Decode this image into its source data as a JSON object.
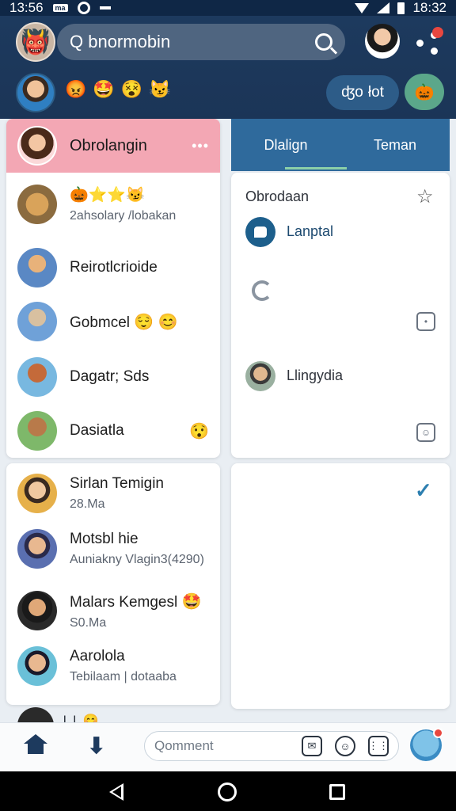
{
  "status_bar": {
    "time_left": "13:56",
    "badge": "ma",
    "time_right": "18:32"
  },
  "header": {
    "search_placeholder": "Q bnormobin",
    "emoji": [
      "😡",
      "🤩",
      "😵",
      "😼"
    ],
    "pill_left": "ʤo",
    "pill_right": "łot",
    "circle_button_icon": "🎃"
  },
  "left_panel_top": {
    "header_title": "Obrolangin",
    "header_more": "•••",
    "items": [
      {
        "name": "🎃⭐⭐😼",
        "sub": "2ahsolary /lobakan",
        "avatar_color": "#8b6b3f"
      },
      {
        "name": "Reirotlcrioide",
        "sub": "",
        "avatar_color": "#5a88c4"
      },
      {
        "name": "Gobmcel",
        "emoji": "😌 😊",
        "sub": "",
        "avatar_color": "#6fa1d8"
      },
      {
        "name": "Dagatr; Sds",
        "sub": "",
        "avatar_color": "#78b8e0"
      },
      {
        "name": "Dasiatla",
        "emoji": "😯",
        "sub": "",
        "avatar_color": "#7eb86a"
      }
    ]
  },
  "left_panel_bottom": {
    "items": [
      {
        "name": "Sirlan Temigin",
        "sub": "28.Ma",
        "avatar_color": "#e6b04a"
      },
      {
        "name": "Motsbl hie",
        "sub": "Auniakny Vlagin3(4290)",
        "avatar_color": "#5a6fb0"
      },
      {
        "name": "Malars Kemgesl",
        "emoji": "🤩",
        "sub": "S0.Ma",
        "avatar_color": "#2a2a2a"
      },
      {
        "name": "Aarolola",
        "sub": "Tebilaam | dotaaba",
        "avatar_color": "#6ac0d8"
      }
    ],
    "partial_label": "l..l..😊"
  },
  "right_panel": {
    "tabs": [
      "Dlalign",
      "Teman"
    ],
    "label": "Obrodaan",
    "item_laptal": "Lanptal",
    "item_person": "Llingydia"
  },
  "bottom_bar": {
    "comment_placeholder": "Qomment"
  }
}
